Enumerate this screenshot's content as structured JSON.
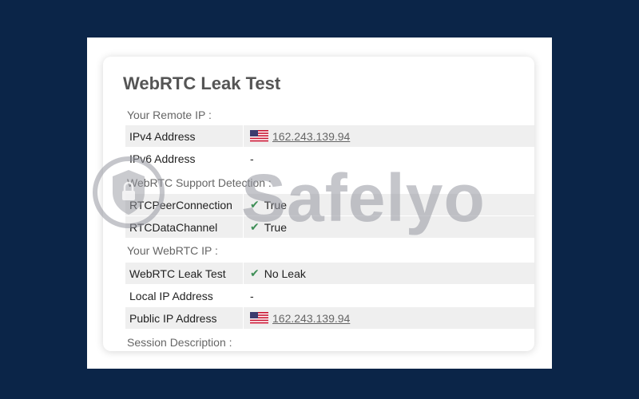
{
  "card": {
    "title": "WebRTC Leak Test"
  },
  "sections": {
    "remote_ip": "Your Remote IP :",
    "support": "WebRTC Support Detection :",
    "webrtc_ip": "Your WebRTC IP :",
    "session": "Session Description :"
  },
  "remote": {
    "ipv4_label": "IPv4 Address",
    "ipv4_value": "162.243.139.94",
    "ipv4_flag": "us-flag-icon",
    "ipv6_label": "IPv6 Address",
    "ipv6_value": "-"
  },
  "support": {
    "peer_label": "RTCPeerConnection",
    "peer_value": "True",
    "data_label": "RTCDataChannel",
    "data_value": "True"
  },
  "webrtc": {
    "leak_label": "WebRTC Leak Test",
    "leak_value": "No Leak",
    "local_label": "Local IP Address",
    "local_value": "-",
    "public_label": "Public IP Address",
    "public_value": "162.243.139.94",
    "public_flag": "us-flag-icon"
  },
  "watermark": {
    "brand": "Safelyo"
  },
  "colors": {
    "background": "#0b2548",
    "check": "#3f8f57",
    "row_shade": "#efefef",
    "title": "#555555"
  }
}
